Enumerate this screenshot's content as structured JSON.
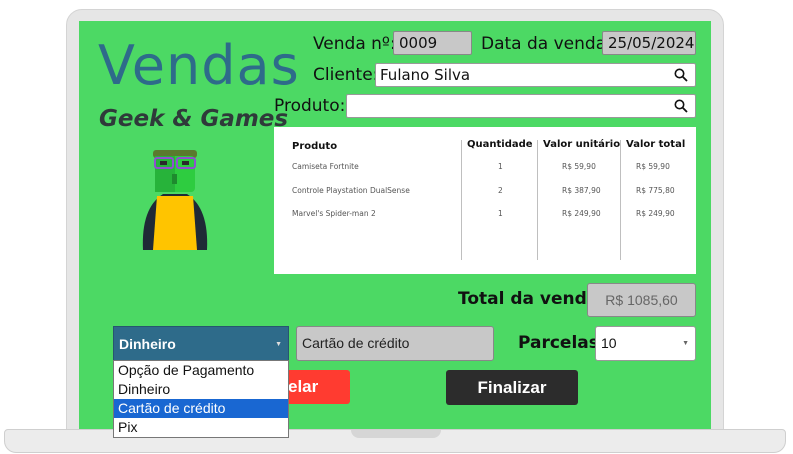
{
  "app": {
    "title": "Vendas",
    "subtitle": "Geek & Games"
  },
  "form": {
    "venda_label": "Venda nº:",
    "venda_value": "0009",
    "data_label": "Data da venda:",
    "data_value": "25/05/2024",
    "cliente_label": "Cliente:",
    "cliente_value": "Fulano Silva",
    "produto_label": "Produto:",
    "produto_value": ""
  },
  "table": {
    "headers": [
      "Produto",
      "Quantidade",
      "Valor unitário",
      "Valor total"
    ],
    "rows": [
      [
        "Camiseta Fortnite",
        "1",
        "R$ 59,90",
        "R$ 59,90"
      ],
      [
        "Controle Playstation DualSense",
        "2",
        "R$ 387,90",
        "R$ 775,80"
      ],
      [
        "Marvel's Spider-man 2",
        "1",
        "R$ 249,90",
        "R$ 249,90"
      ]
    ]
  },
  "total": {
    "label": "Total da venda:",
    "value": "R$ 1085,60"
  },
  "payment": {
    "selected": "Dinheiro",
    "options": [
      "Opção de Pagamento",
      "Dinheiro",
      "Cartão de crédito",
      "Pix"
    ],
    "highlighted_option": "Cartão de crédito",
    "card_field": "Cartão de crédito",
    "parcelas_label": "Parcelas:",
    "parcelas_value": "10"
  },
  "buttons": {
    "cancel_label_visible": "elar",
    "finish_label": "Finalizar"
  },
  "colors": {
    "screen_bg": "#4cd964",
    "title": "#2e6b8a",
    "select_bg": "#2e6b8a",
    "cancel": "#ff3b30",
    "finish": "#2c2c2c",
    "highlight": "#1967d2"
  },
  "icons": [
    "search-icon",
    "search-icon",
    "mascot-icon",
    "chevron-down-icon"
  ]
}
